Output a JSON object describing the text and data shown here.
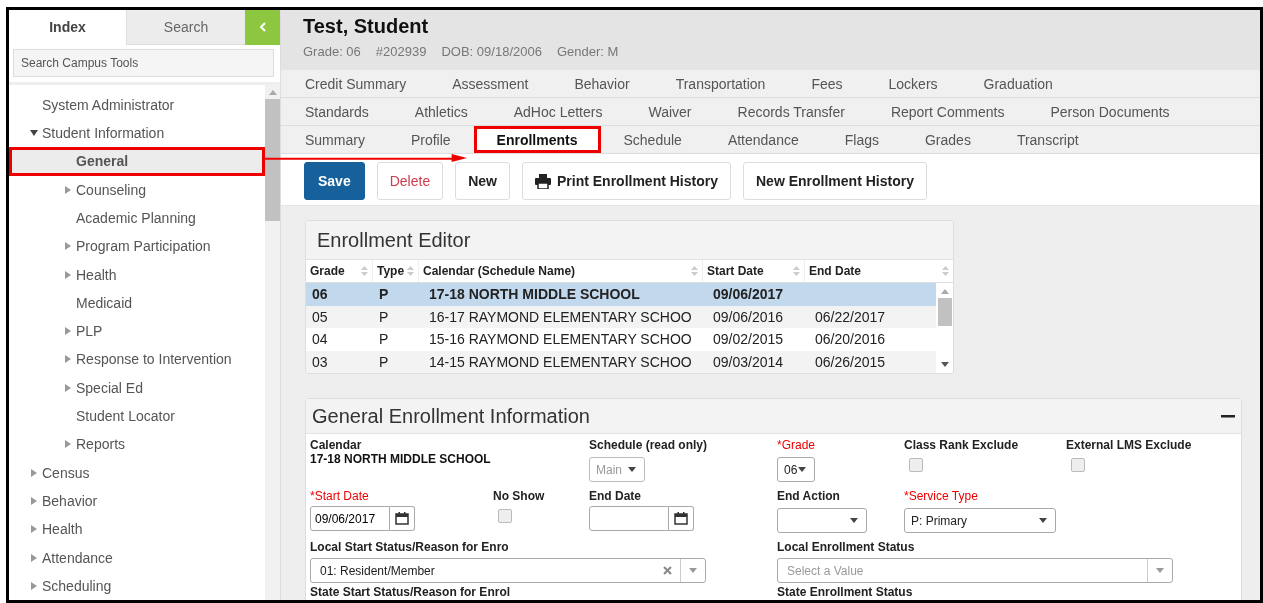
{
  "sidebar": {
    "tabs": [
      {
        "label": "Index",
        "selected": true
      },
      {
        "label": "Search",
        "selected": false
      }
    ],
    "search": {
      "placeholder": "Search Campus Tools"
    },
    "tree": [
      {
        "label": "System Administrator",
        "kind": "item",
        "selected": false,
        "annotated": false
      },
      {
        "label": "Student Information",
        "kind": "group",
        "expanded": true,
        "selected": false,
        "annotated": false,
        "children": [
          {
            "label": "General",
            "kind": "item",
            "selected": true,
            "annotated": true
          },
          {
            "label": "Counseling",
            "kind": "group",
            "expanded": false,
            "selected": false,
            "annotated": false
          },
          {
            "label": "Academic Planning",
            "kind": "item",
            "selected": false,
            "annotated": false
          },
          {
            "label": "Program Participation",
            "kind": "group",
            "expanded": false,
            "selected": false,
            "annotated": false
          },
          {
            "label": "Health",
            "kind": "group",
            "expanded": false,
            "selected": false,
            "annotated": false
          },
          {
            "label": "Medicaid",
            "kind": "item",
            "selected": false,
            "annotated": false
          },
          {
            "label": "PLP",
            "kind": "group",
            "expanded": false,
            "selected": false,
            "annotated": false
          },
          {
            "label": "Response to Intervention",
            "kind": "group",
            "expanded": false,
            "selected": false,
            "annotated": false
          },
          {
            "label": "Special Ed",
            "kind": "group",
            "expanded": false,
            "selected": false,
            "annotated": false
          },
          {
            "label": "Student Locator",
            "kind": "item",
            "selected": false,
            "annotated": false
          },
          {
            "label": "Reports",
            "kind": "group",
            "expanded": false,
            "selected": false,
            "annotated": false
          }
        ]
      },
      {
        "label": "Census",
        "kind": "group",
        "expanded": false,
        "selected": false,
        "annotated": false
      },
      {
        "label": "Behavior",
        "kind": "group",
        "expanded": false,
        "selected": false,
        "annotated": false
      },
      {
        "label": "Health",
        "kind": "group",
        "expanded": false,
        "selected": false,
        "annotated": false
      },
      {
        "label": "Attendance",
        "kind": "group",
        "expanded": false,
        "selected": false,
        "annotated": false
      },
      {
        "label": "Scheduling",
        "kind": "group",
        "expanded": false,
        "selected": false,
        "annotated": false
      }
    ]
  },
  "student": {
    "name": "Test, Student",
    "details": [
      "Grade: 06",
      "#202939",
      "DOB: 09/18/2006",
      "Gender: M"
    ]
  },
  "tab_rows": [
    [
      {
        "label": "Credit Summary",
        "selected": false,
        "annotated": false
      },
      {
        "label": "Assessment",
        "selected": false,
        "annotated": false
      },
      {
        "label": "Behavior",
        "selected": false,
        "annotated": false
      },
      {
        "label": "Transportation",
        "selected": false,
        "annotated": false
      },
      {
        "label": "Fees",
        "selected": false,
        "annotated": false
      },
      {
        "label": "Lockers",
        "selected": false,
        "annotated": false
      },
      {
        "label": "Graduation",
        "selected": false,
        "annotated": false
      }
    ],
    [
      {
        "label": "Standards",
        "selected": false,
        "annotated": false
      },
      {
        "label": "Athletics",
        "selected": false,
        "annotated": false
      },
      {
        "label": "AdHoc Letters",
        "selected": false,
        "annotated": false
      },
      {
        "label": "Waiver",
        "selected": false,
        "annotated": false
      },
      {
        "label": "Records Transfer",
        "selected": false,
        "annotated": false
      },
      {
        "label": "Report Comments",
        "selected": false,
        "annotated": false
      },
      {
        "label": "Person Documents",
        "selected": false,
        "annotated": false
      }
    ],
    [
      {
        "label": "Summary",
        "selected": false,
        "annotated": false
      },
      {
        "label": "Profile",
        "selected": false,
        "annotated": false
      },
      {
        "label": "Enrollments",
        "selected": true,
        "annotated": true
      },
      {
        "label": "Schedule",
        "selected": false,
        "annotated": false
      },
      {
        "label": "Attendance",
        "selected": false,
        "annotated": false
      },
      {
        "label": "Flags",
        "selected": false,
        "annotated": false
      },
      {
        "label": "Grades",
        "selected": false,
        "annotated": false
      },
      {
        "label": "Transcript",
        "selected": false,
        "annotated": false
      }
    ]
  ],
  "toolbar": [
    {
      "label": "Save",
      "kind": "primary"
    },
    {
      "label": "Delete",
      "kind": "danger"
    },
    {
      "label": "New",
      "kind": "plain"
    },
    {
      "label": "Print Enrollment History",
      "kind": "print"
    },
    {
      "label": "New Enrollment History",
      "kind": "plain"
    }
  ],
  "enrollment_editor": {
    "title": "Enrollment Editor",
    "columns": [
      "Grade",
      "Type",
      "Calendar (Schedule Name)",
      "Start Date",
      "End Date"
    ],
    "rows": [
      {
        "cells": [
          "06",
          "P",
          "17-18 NORTH MIDDLE SCHOOL",
          "09/06/2017",
          ""
        ],
        "selected": true
      },
      {
        "cells": [
          "05",
          "P",
          "16-17 RAYMOND ELEMENTARY SCHOO",
          "09/06/2016",
          "06/22/2017"
        ],
        "selected": false
      },
      {
        "cells": [
          "04",
          "P",
          "15-16 RAYMOND ELEMENTARY SCHOO",
          "09/02/2015",
          "06/20/2016"
        ],
        "selected": false
      },
      {
        "cells": [
          "03",
          "P",
          "14-15 RAYMOND ELEMENTARY SCHOO",
          "09/03/2014",
          "06/26/2015"
        ],
        "selected": false
      }
    ]
  },
  "general_info": {
    "title": "General Enrollment Information",
    "fields": [
      {
        "kind": "text",
        "label": "Calendar",
        "required": false,
        "value": "17-18 NORTH MIDDLE SCHOOL"
      },
      {
        "kind": "select",
        "label": "Schedule (read only)",
        "required": false,
        "value": "Main",
        "disabled": true
      },
      {
        "kind": "select",
        "label": "*Grade",
        "required": true,
        "value": "06",
        "disabled": false
      },
      {
        "kind": "checkbox",
        "label": "Class Rank Exclude",
        "required": false,
        "checked": false
      },
      {
        "kind": "checkbox",
        "label": "External LMS Exclude",
        "required": false,
        "checked": false
      },
      {
        "kind": "date",
        "label": "*Start Date",
        "required": true,
        "value": "09/06/2017"
      },
      {
        "kind": "checkbox",
        "label": "No Show",
        "required": false,
        "checked": false
      },
      {
        "kind": "date",
        "label": "End Date",
        "required": false
      },
      {
        "kind": "select",
        "label": "End Action",
        "required": false,
        "disabled": false
      },
      {
        "kind": "select",
        "label": "*Service Type",
        "required": true,
        "value": "P: Primary",
        "disabled": false
      },
      {
        "kind": "combo",
        "label": "Local Start Status/Reason for Enro",
        "required": false,
        "value": "01: Resident/Member"
      },
      {
        "kind": "combo",
        "label": "Local Enrollment Status",
        "required": false,
        "placeholder": "Select a Value"
      },
      {
        "kind": "label",
        "label": "State Start Status/Reason for Enrol",
        "required": false
      },
      {
        "kind": "label",
        "label": "State Enrollment Status",
        "required": false
      }
    ]
  }
}
